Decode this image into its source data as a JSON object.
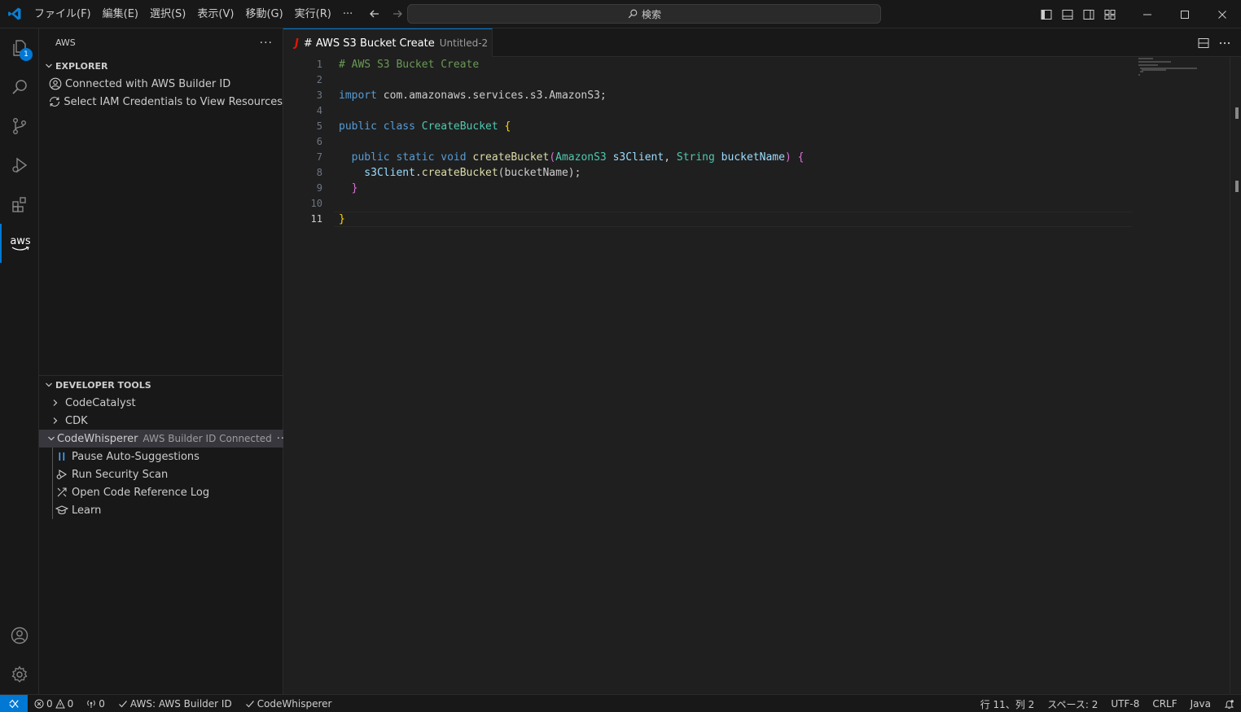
{
  "menu": [
    "ファイル(F)",
    "編集(E)",
    "選択(S)",
    "表示(V)",
    "移動(G)",
    "実行(R)",
    "···"
  ],
  "search": {
    "placeholder": "検索"
  },
  "colors": {
    "accent": "#0078d4",
    "java_icon": "#e51400"
  },
  "activity": {
    "explorer_badge": "1",
    "aws_label": "aws"
  },
  "sidebar": {
    "title": "AWS",
    "more": "···",
    "explorer": {
      "title": "EXPLORER",
      "items": [
        {
          "icon": "account-icon",
          "label": "Connected with AWS Builder ID"
        },
        {
          "icon": "sync-icon",
          "label": "Select IAM Credentials to View Resources"
        }
      ]
    },
    "devtools": {
      "title": "DEVELOPER TOOLS",
      "items": [
        {
          "label": "CodeCatalyst"
        },
        {
          "label": "CDK"
        },
        {
          "label": "CodeWhisperer",
          "desc": "AWS Builder ID Connected",
          "more": "···"
        }
      ],
      "children": [
        {
          "icon": "pause-icon",
          "label": "Pause Auto-Suggestions"
        },
        {
          "icon": "security-scan-icon",
          "label": "Run Security Scan"
        },
        {
          "icon": "code-reference-icon",
          "label": "Open Code Reference Log"
        },
        {
          "icon": "learn-icon",
          "label": "Learn"
        }
      ]
    }
  },
  "tab": {
    "icon": "J",
    "title": "# AWS S3 Bucket Create",
    "desc": "Untitled-2"
  },
  "editor": {
    "line_numbers": [
      "1",
      "2",
      "3",
      "4",
      "5",
      "6",
      "7",
      "8",
      "9",
      "10",
      "11"
    ],
    "current_line": "11",
    "lines": [
      [
        {
          "t": "# AWS S3 Bucket Create",
          "c": "cm"
        }
      ],
      [],
      [
        {
          "t": "import ",
          "c": "kw"
        },
        {
          "t": "com.amazonaws.services.s3.AmazonS3;",
          "c": ""
        }
      ],
      [],
      [
        {
          "t": "public ",
          "c": "kw"
        },
        {
          "t": "class ",
          "c": "kw"
        },
        {
          "t": "CreateBucket ",
          "c": "cls"
        },
        {
          "t": "{",
          "c": "br1"
        }
      ],
      [],
      [
        {
          "t": "  public ",
          "c": "kw"
        },
        {
          "t": "static ",
          "c": "kw"
        },
        {
          "t": "void ",
          "c": "kw"
        },
        {
          "t": "createBucket",
          "c": "fn"
        },
        {
          "t": "(",
          "c": "br2"
        },
        {
          "t": "AmazonS3 ",
          "c": "cls"
        },
        {
          "t": "s3Client",
          "c": "var"
        },
        {
          "t": ", ",
          "c": ""
        },
        {
          "t": "String ",
          "c": "cls"
        },
        {
          "t": "bucketName",
          "c": "var"
        },
        {
          "t": ") {",
          "c": "br2"
        }
      ],
      [
        {
          "t": "    s3Client",
          "c": "var"
        },
        {
          "t": ".",
          "c": ""
        },
        {
          "t": "createBucket",
          "c": "fn"
        },
        {
          "t": "(bucketName);",
          "c": ""
        }
      ],
      [
        {
          "t": "  }",
          "c": "br2"
        }
      ],
      [],
      [
        {
          "t": "}",
          "c": "br1"
        }
      ]
    ]
  },
  "status": {
    "errors": "0",
    "warnings": "0",
    "ports": "0",
    "aws": "AWS: AWS Builder ID",
    "codewhisperer": "CodeWhisperer",
    "position": "行 11、列 2",
    "spaces": "スペース: 2",
    "encoding": "UTF-8",
    "eol": "CRLF",
    "language": "Java"
  }
}
